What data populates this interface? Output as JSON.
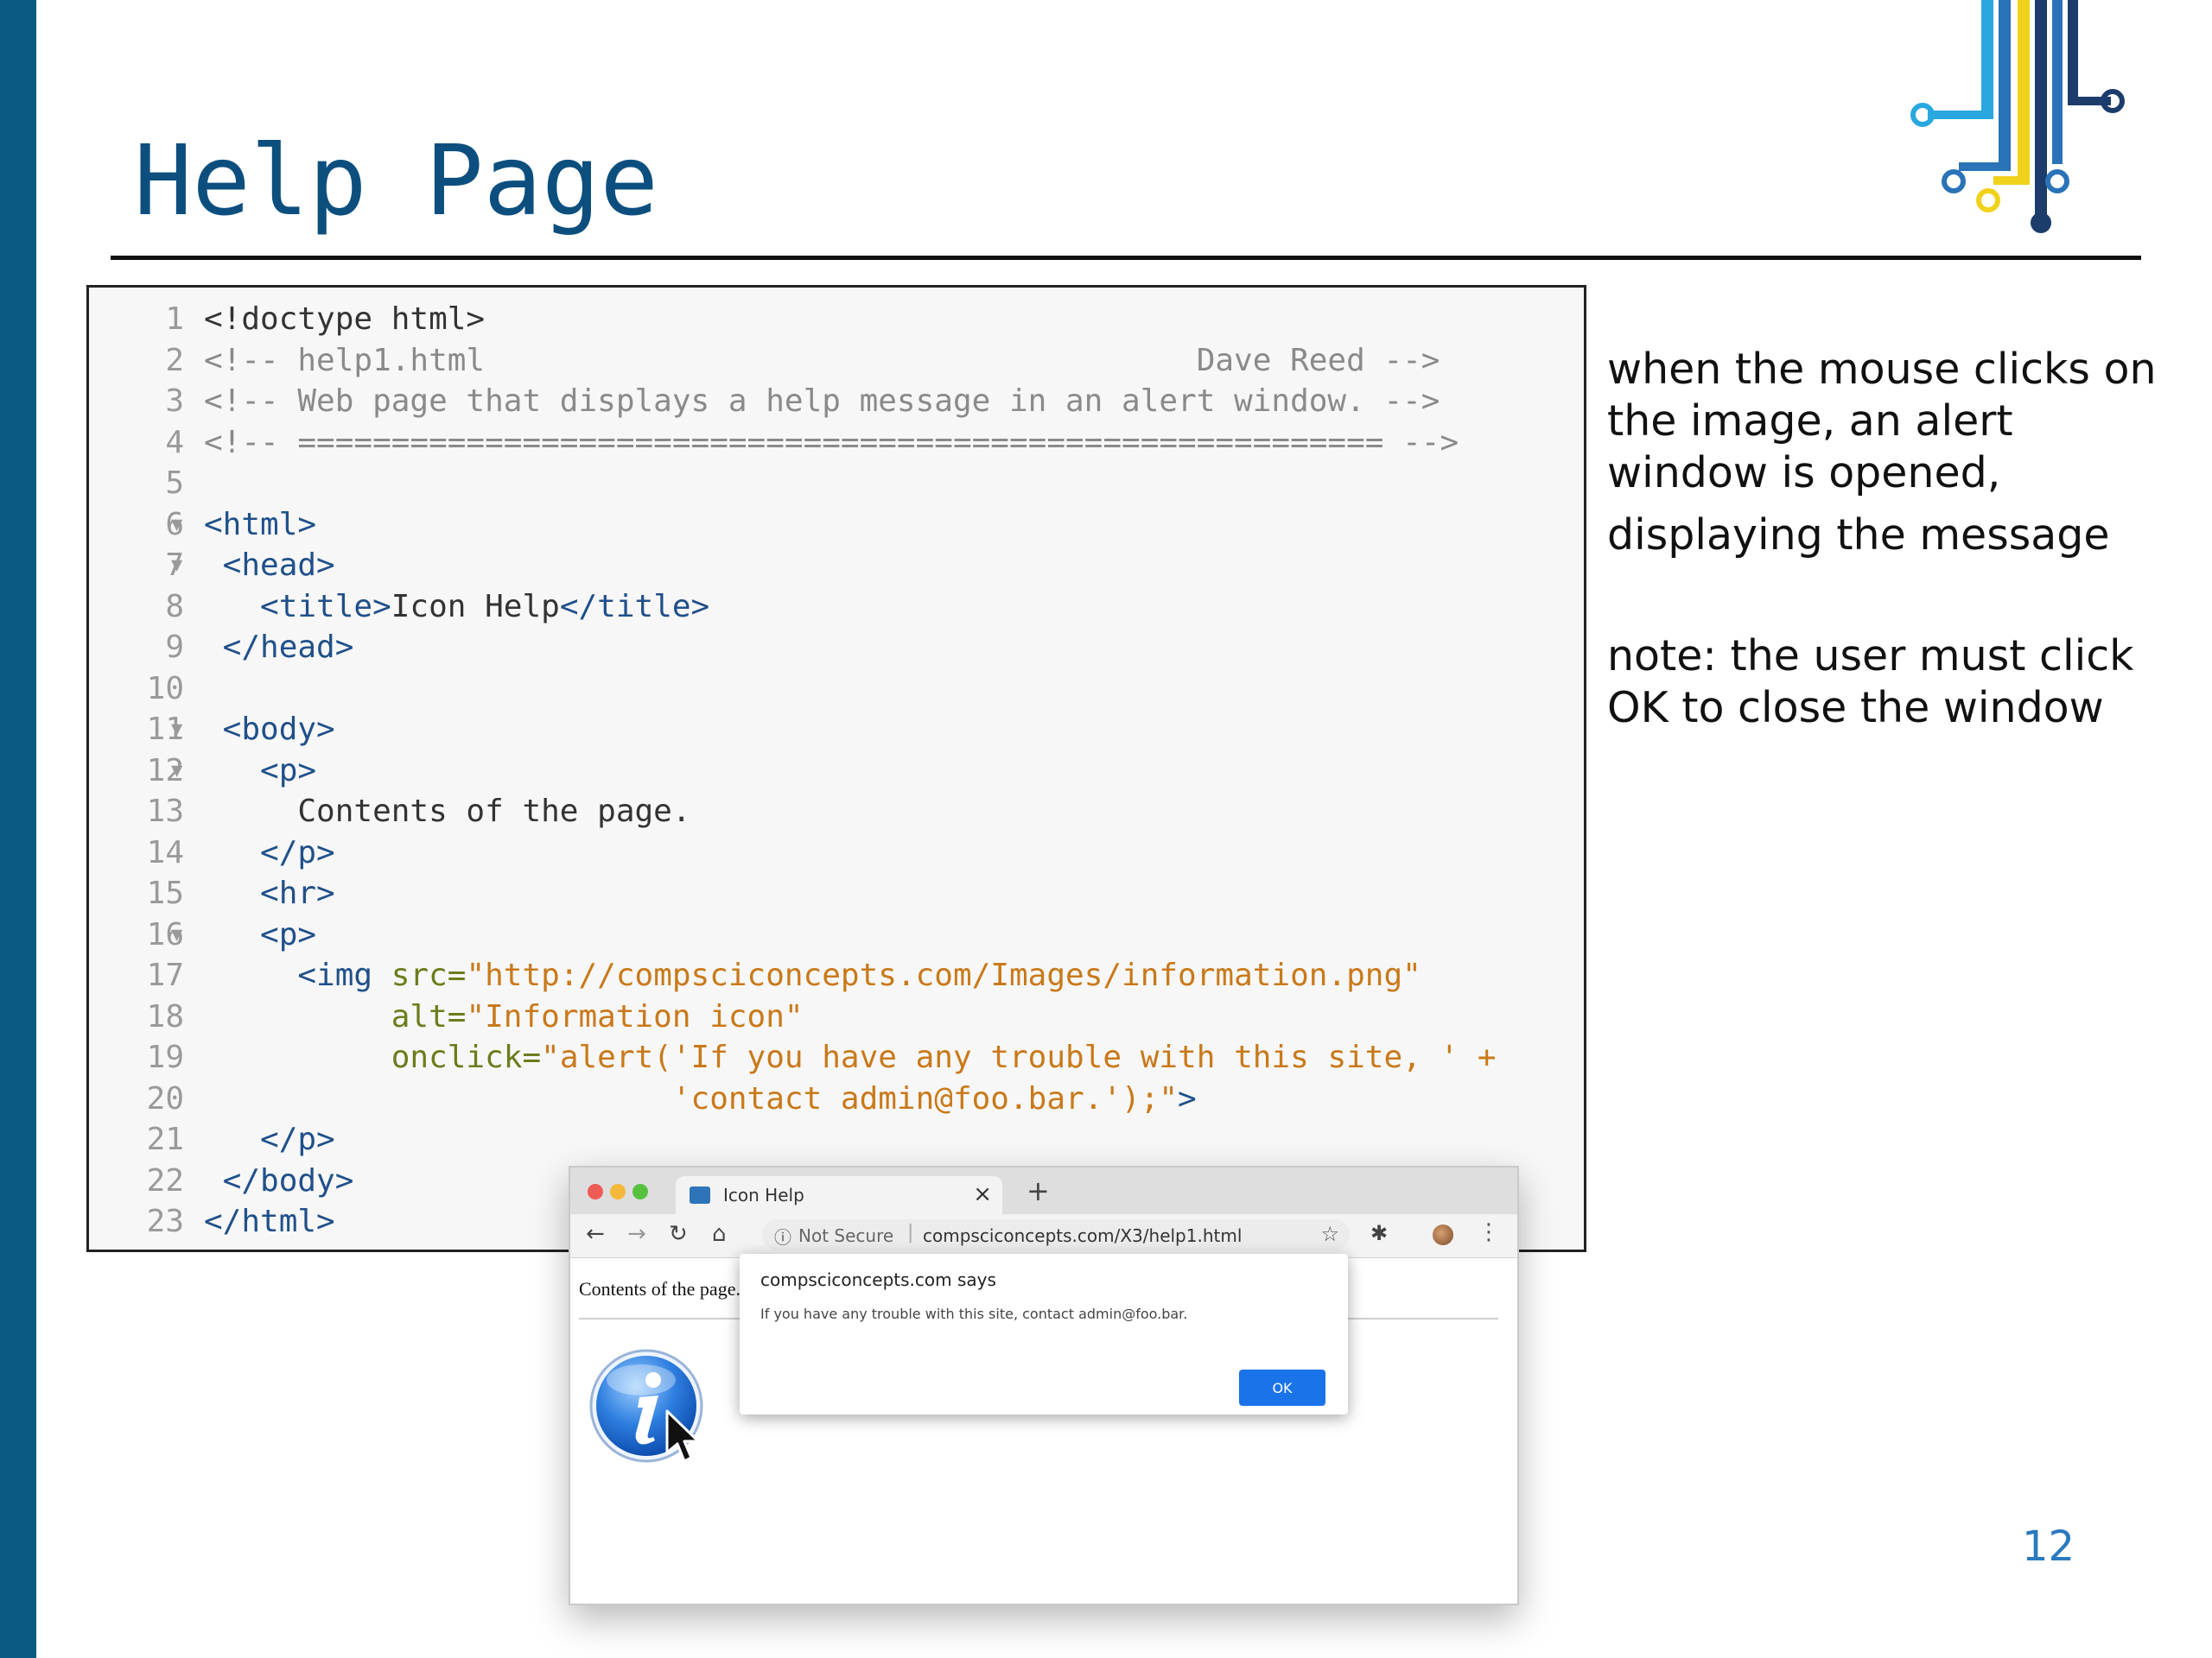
{
  "slide": {
    "title": "Help Page",
    "page_number": "12",
    "notes": [
      "when the mouse clicks on",
      "the image, an alert",
      "window is opened,",
      "displaying the message",
      "note: the user must click",
      "OK to close the window"
    ]
  },
  "code": {
    "lines": [
      {
        "n": "1",
        "fold": false,
        "parts": [
          {
            "t": "<!doctype html>",
            "c": "plain"
          }
        ]
      },
      {
        "n": "2",
        "fold": false,
        "parts": [
          {
            "t": "<!-- help1.html                                      Dave Reed -->",
            "c": "comment"
          }
        ]
      },
      {
        "n": "3",
        "fold": false,
        "parts": [
          {
            "t": "<!-- Web page that displays a help message in an alert window. -->",
            "c": "comment"
          }
        ]
      },
      {
        "n": "4",
        "fold": false,
        "parts": [
          {
            "t": "<!-- ========================================================== -->",
            "c": "comment"
          }
        ]
      },
      {
        "n": "5",
        "fold": false,
        "parts": []
      },
      {
        "n": "6",
        "fold": true,
        "parts": [
          {
            "t": "<html>",
            "c": "tag"
          }
        ]
      },
      {
        "n": "7",
        "fold": true,
        "parts": [
          {
            "t": " <head>",
            "c": "tag"
          }
        ]
      },
      {
        "n": "8",
        "fold": false,
        "parts": [
          {
            "t": "   <title>",
            "c": "tag"
          },
          {
            "t": "Icon Help",
            "c": "plain"
          },
          {
            "t": "</title>",
            "c": "tag"
          }
        ]
      },
      {
        "n": "9",
        "fold": false,
        "parts": [
          {
            "t": " </head>",
            "c": "tag"
          }
        ]
      },
      {
        "n": "10",
        "fold": false,
        "parts": []
      },
      {
        "n": "11",
        "fold": true,
        "parts": [
          {
            "t": " <body>",
            "c": "tag"
          }
        ]
      },
      {
        "n": "12",
        "fold": true,
        "parts": [
          {
            "t": "   <p>",
            "c": "tag"
          }
        ]
      },
      {
        "n": "13",
        "fold": false,
        "parts": [
          {
            "t": "     Contents of the page.",
            "c": "plain"
          }
        ]
      },
      {
        "n": "14",
        "fold": false,
        "parts": [
          {
            "t": "   </p>",
            "c": "tag"
          }
        ]
      },
      {
        "n": "15",
        "fold": false,
        "parts": [
          {
            "t": "   <hr>",
            "c": "tag"
          }
        ]
      },
      {
        "n": "16",
        "fold": true,
        "parts": [
          {
            "t": "   <p>",
            "c": "tag"
          }
        ]
      },
      {
        "n": "17",
        "fold": false,
        "parts": [
          {
            "t": "     <img ",
            "c": "tag"
          },
          {
            "t": "src=",
            "c": "attr"
          },
          {
            "t": "\"http://compsciconcepts.com/Images/information.png\"",
            "c": "str"
          }
        ]
      },
      {
        "n": "18",
        "fold": false,
        "parts": [
          {
            "t": "          alt=",
            "c": "attr"
          },
          {
            "t": "\"Information icon\"",
            "c": "str"
          }
        ]
      },
      {
        "n": "19",
        "fold": false,
        "parts": [
          {
            "t": "          onclick=",
            "c": "attr"
          },
          {
            "t": "\"alert('If you have any trouble with this site, ' +",
            "c": "str"
          }
        ]
      },
      {
        "n": "20",
        "fold": false,
        "parts": [
          {
            "t": "                         'contact admin@foo.bar.');\"",
            "c": "str"
          },
          {
            "t": ">",
            "c": "tag"
          }
        ]
      },
      {
        "n": "21",
        "fold": false,
        "parts": [
          {
            "t": "   </p>",
            "c": "tag"
          }
        ]
      },
      {
        "n": "22",
        "fold": false,
        "parts": [
          {
            "t": " </body>",
            "c": "tag"
          }
        ]
      },
      {
        "n": "23",
        "fold": false,
        "parts": [
          {
            "t": "</html>",
            "c": "tag"
          }
        ]
      }
    ]
  },
  "browser": {
    "tab_title": "Icon Help",
    "tab_close": "×",
    "new_tab": "+",
    "url_security": "Not Secure",
    "url_separator": "|",
    "url": "compsciconcepts.com/X3/help1.html",
    "page_text": "Contents of the page.",
    "dialog": {
      "title": "compsciconcepts.com says",
      "message": "If you have any trouble with this site, contact admin@foo.bar.",
      "ok_label": "OK"
    }
  },
  "colors": {
    "accent_bar": "#0b5a86",
    "title": "#0c4f7f",
    "tag": "#20508a",
    "string": "#c9791a",
    "attribute": "#6a7d1c",
    "comment": "#8a8a8a",
    "ok_button": "#1a73e8",
    "page_number": "#2a7ac0"
  },
  "icons": {
    "logo": "circuit-logo-icon",
    "info": "information-icon",
    "cursor": "mouse-pointer-icon"
  }
}
